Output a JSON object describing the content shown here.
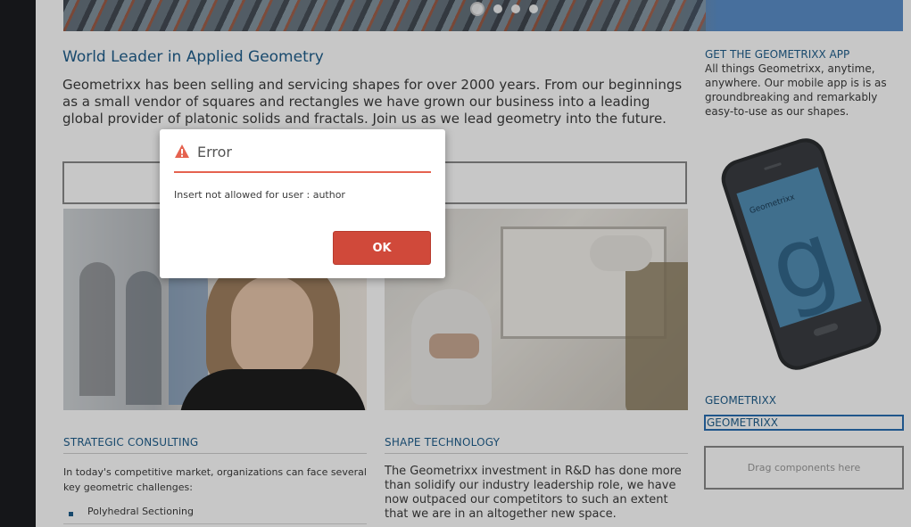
{
  "page": {
    "headline": "World Leader in Applied Geometry",
    "intro": "Geometrixx has been selling and servicing shapes for over 2000 years. From our beginnings as a small vendor of squares and rectangles we have grown our business into a leading global provider of platonic solids and fractals. Join us as we lead geometry into the future."
  },
  "carousel": {
    "slide_count": 4,
    "active_slide": 1
  },
  "sections": [
    {
      "title": "STRATEGIC CONSULTING",
      "text": "In today's competitive market, organizations can face several key geometric challenges:",
      "bullets": [
        "Polyhedral Sectioning"
      ]
    },
    {
      "title": "SHAPE TECHNOLOGY",
      "text": "The Geometrixx investment in R&D has done more than solidify our industry leadership role, we have now outpaced our competitors to such an extent that we are in an altogether new space."
    }
  ],
  "sidebar": {
    "app_title": "GET THE GEOMETRIXX APP",
    "app_text": "All things Geometrixx, anytime, anywhere. Our mobile app is is as groundbreaking and remarkably easy-to-use as our shapes.",
    "phone_brand": "Geometrixx",
    "geo_label": "GEOMETRIXX",
    "geo_selected": "GEOMETRIXX",
    "drag_placeholder": "Drag components here"
  },
  "dialog": {
    "title": "Error",
    "message": "Insert not allowed for user : author",
    "ok_label": "OK",
    "icon": "warning-icon",
    "accent_color": "#e5624f",
    "button_color": "#d0493a"
  }
}
